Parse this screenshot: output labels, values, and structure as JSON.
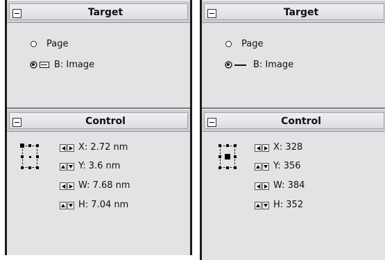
{
  "panels": [
    {
      "target": {
        "title": "Target",
        "options": [
          {
            "label": "Page",
            "selected": false
          },
          {
            "label": "B: Image",
            "selected": true,
            "icon": "image-thumb-icon"
          }
        ]
      },
      "control": {
        "title": "Control",
        "anchor": "center",
        "fields": [
          {
            "label": "X: 2.72 nm",
            "stepper": "horizontal"
          },
          {
            "label": "Y: 3.6 nm",
            "stepper": "vertical"
          },
          {
            "label": "W: 7.68 nm",
            "stepper": "horizontal"
          },
          {
            "label": "H: 7.04 nm",
            "stepper": "vertical"
          }
        ]
      }
    },
    {
      "target": {
        "title": "Target",
        "options": [
          {
            "label": "Page",
            "selected": false
          },
          {
            "label": "B: Image",
            "selected": true,
            "icon": "line-icon"
          }
        ]
      },
      "control": {
        "title": "Control",
        "anchor": "center",
        "fields": [
          {
            "label": "X: 328",
            "stepper": "horizontal"
          },
          {
            "label": "Y: 356",
            "stepper": "vertical"
          },
          {
            "label": "W: 384",
            "stepper": "horizontal"
          },
          {
            "label": "H: 352",
            "stepper": "vertical"
          }
        ]
      }
    }
  ]
}
